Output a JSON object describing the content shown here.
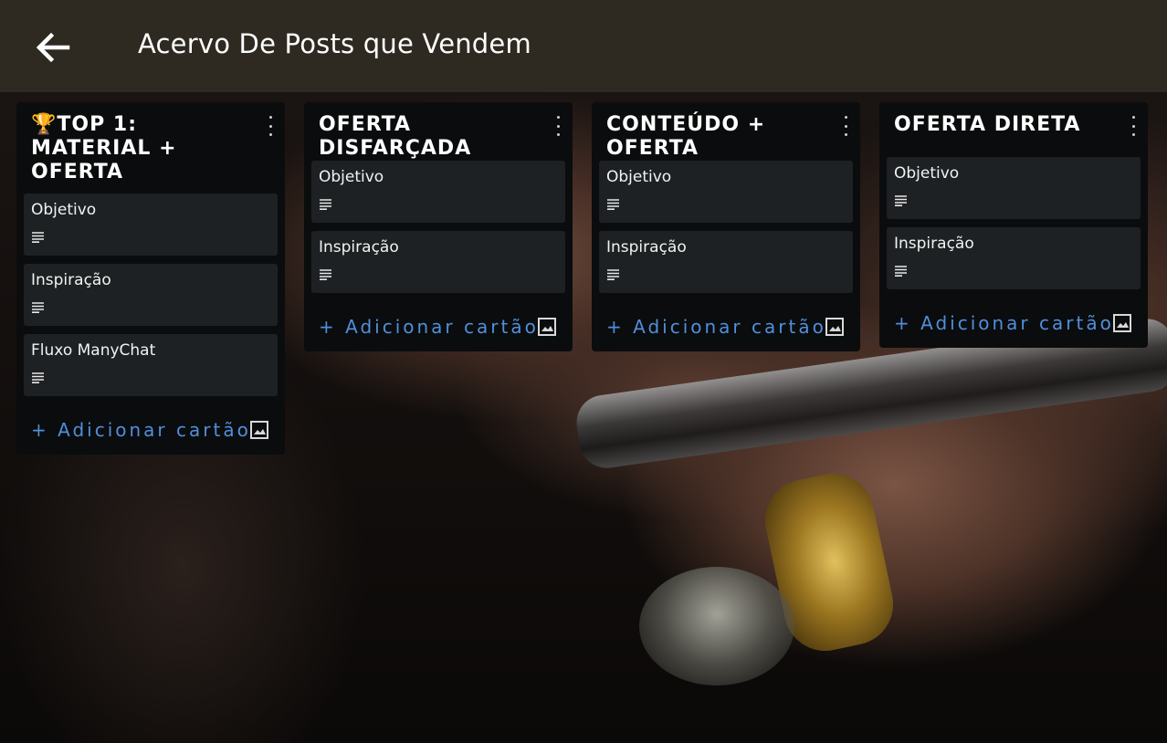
{
  "app_bar": {
    "back_icon": "arrow-left-icon",
    "title": "Acervo De Posts que Vendem"
  },
  "lists": [
    {
      "title": "🏆TOP 1: MATERIAL + OFERTA",
      "cards": [
        {
          "title": "Objetivo",
          "icon": "description-icon"
        },
        {
          "title": "Inspiração",
          "icon": "description-icon"
        },
        {
          "title": "Fluxo ManyChat",
          "icon": "description-icon"
        }
      ],
      "add_card_label": "+ Adicionar cartão"
    },
    {
      "title": "OFERTA DISFARÇADA",
      "cards": [
        {
          "title": "Objetivo",
          "icon": "description-icon"
        },
        {
          "title": "Inspiração",
          "icon": "description-icon"
        }
      ],
      "add_card_label": "+ Adicionar cartão"
    },
    {
      "title": "CONTEÚDO + OFERTA",
      "cards": [
        {
          "title": "Objetivo",
          "icon": "description-icon"
        },
        {
          "title": "Inspiração",
          "icon": "description-icon"
        }
      ],
      "add_card_label": "+ Adicionar cartão"
    },
    {
      "title": "OFERTA DIRETA",
      "cards": [
        {
          "title": "Objetivo",
          "icon": "description-icon"
        },
        {
          "title": "Inspiração",
          "icon": "description-icon"
        }
      ],
      "add_card_label": "+ Adicionar cartão"
    }
  ],
  "colors": {
    "app_bar": "#2e2a21",
    "list_bg": "#0b0c0d",
    "card_bg": "#1e2123",
    "add_card_text": "#4f8fdc"
  }
}
